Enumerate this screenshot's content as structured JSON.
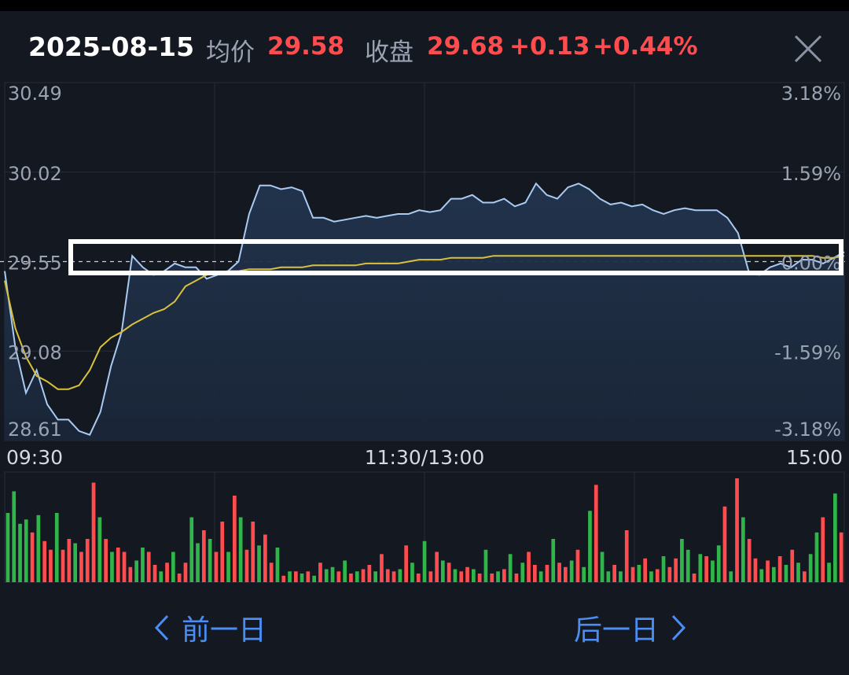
{
  "header": {
    "date": "2025-08-15",
    "avg_label": "均价",
    "avg_value": "29.58",
    "close_label": "收盘",
    "close_value": "29.68",
    "change": "+0.13",
    "change_pct": "+0.44%"
  },
  "footer": {
    "prev_label": "前一日",
    "next_label": "后一日"
  },
  "colors": {
    "background": "#141821",
    "price_line": "#a9cbf2",
    "avg_line": "#d9c23a",
    "up": "#ff4d4f",
    "down": "#2fb54a",
    "nav": "#4a8df5",
    "axis_text": "#9aa3b2"
  },
  "chart_data": {
    "type": "line",
    "x_ticks": [
      "09:30",
      "11:30/13:00",
      "15:00"
    ],
    "y_left_ticks": [
      "30.49",
      "30.02",
      "29.55",
      "29.08",
      "28.61"
    ],
    "y_right_ticks": [
      "3.18%",
      "1.59%",
      "0.00%",
      "-1.59%",
      "-3.18%"
    ],
    "ylim": [
      28.61,
      30.49
    ],
    "prev_close": 29.55,
    "grid": true,
    "price": [
      29.5,
      29.1,
      28.86,
      28.98,
      28.8,
      28.72,
      28.72,
      28.66,
      28.64,
      28.76,
      29.0,
      29.18,
      29.58,
      29.52,
      29.48,
      29.5,
      29.54,
      29.52,
      29.52,
      29.46,
      29.48,
      29.5,
      29.55,
      29.8,
      29.95,
      29.95,
      29.93,
      29.94,
      29.92,
      29.78,
      29.78,
      29.76,
      29.77,
      29.78,
      29.79,
      29.78,
      29.79,
      29.8,
      29.8,
      29.82,
      29.81,
      29.82,
      29.88,
      29.88,
      29.9,
      29.86,
      29.86,
      29.88,
      29.84,
      29.86,
      29.96,
      29.9,
      29.88,
      29.94,
      29.96,
      29.93,
      29.88,
      29.85,
      29.86,
      29.84,
      29.85,
      29.82,
      29.8,
      29.82,
      29.83,
      29.82,
      29.82,
      29.82,
      29.78,
      29.7,
      29.5,
      29.48,
      29.52,
      29.54,
      29.52,
      29.56,
      29.56,
      29.54,
      29.57,
      29.6
    ],
    "avg": [
      29.45,
      29.2,
      29.05,
      28.95,
      28.92,
      28.88,
      28.88,
      28.9,
      28.98,
      29.1,
      29.15,
      29.18,
      29.22,
      29.25,
      29.28,
      29.3,
      29.34,
      29.42,
      29.45,
      29.48,
      29.49,
      29.5,
      29.5,
      29.51,
      29.51,
      29.51,
      29.52,
      29.52,
      29.52,
      29.53,
      29.53,
      29.53,
      29.53,
      29.53,
      29.54,
      29.54,
      29.54,
      29.54,
      29.55,
      29.56,
      29.56,
      29.56,
      29.57,
      29.57,
      29.57,
      29.57,
      29.58,
      29.58,
      29.58,
      29.58,
      29.58,
      29.58,
      29.58,
      29.58,
      29.58,
      29.58,
      29.58,
      29.58,
      29.58,
      29.58,
      29.58,
      29.58,
      29.58,
      29.58,
      29.58,
      29.58,
      29.58,
      29.58,
      29.58,
      29.58,
      29.58,
      29.58,
      29.58,
      29.58,
      29.58,
      29.58,
      29.58,
      29.57,
      29.57,
      29.58
    ],
    "volume": [
      64,
      84,
      54,
      58,
      46,
      62,
      38,
      30,
      64,
      30,
      40,
      36,
      28,
      40,
      92,
      60,
      40,
      28,
      32,
      28,
      14,
      20,
      32,
      28,
      16,
      10,
      18,
      28,
      8,
      18,
      60,
      36,
      48,
      40,
      28,
      56,
      28,
      80,
      60,
      30,
      56,
      34,
      44,
      18,
      32,
      6,
      10,
      10,
      8,
      10,
      6,
      18,
      12,
      14,
      10,
      20,
      8,
      10,
      12,
      16,
      10,
      26,
      12,
      10,
      12,
      34,
      18,
      8,
      38,
      10,
      28,
      20,
      18,
      12,
      10,
      14,
      12,
      8,
      30,
      8,
      10,
      12,
      26,
      8,
      18,
      28,
      16,
      10,
      16,
      40,
      18,
      14,
      20,
      30,
      14,
      66,
      90,
      28,
      10,
      16,
      10,
      48,
      14,
      16,
      22,
      10,
      12,
      24,
      14,
      22,
      40,
      30,
      8,
      26,
      24,
      20,
      34,
      70,
      10,
      96,
      60,
      40,
      22,
      12,
      20,
      14,
      24,
      16,
      30,
      18,
      10,
      26,
      46,
      60,
      18,
      82,
      46
    ],
    "volume_up": [
      0,
      0,
      0,
      0,
      1,
      0,
      1,
      1,
      0,
      1,
      1,
      0,
      1,
      1,
      1,
      0,
      1,
      0,
      1,
      1,
      1,
      0,
      0,
      1,
      1,
      0,
      1,
      0,
      1,
      1,
      0,
      0,
      1,
      0,
      1,
      1,
      0,
      1,
      0,
      1,
      1,
      0,
      1,
      1,
      0,
      1,
      0,
      1,
      0,
      1,
      0,
      1,
      0,
      0,
      1,
      0,
      1,
      0,
      1,
      1,
      0,
      1,
      1,
      1,
      0,
      1,
      0,
      1,
      0,
      1,
      1,
      0,
      1,
      0,
      1,
      1,
      0,
      1,
      0,
      1,
      0,
      1,
      0,
      1,
      0,
      1,
      1,
      0,
      1,
      0,
      1,
      1,
      0,
      1,
      0,
      0,
      1,
      0,
      0,
      1,
      0,
      1,
      1,
      0,
      1,
      0,
      1,
      0,
      1,
      1,
      0,
      0,
      1,
      0,
      1,
      0,
      0,
      1,
      0,
      1,
      0,
      1,
      1,
      0,
      1,
      0,
      1,
      0,
      1,
      0,
      1,
      0,
      0,
      1,
      0,
      0,
      1
    ]
  }
}
